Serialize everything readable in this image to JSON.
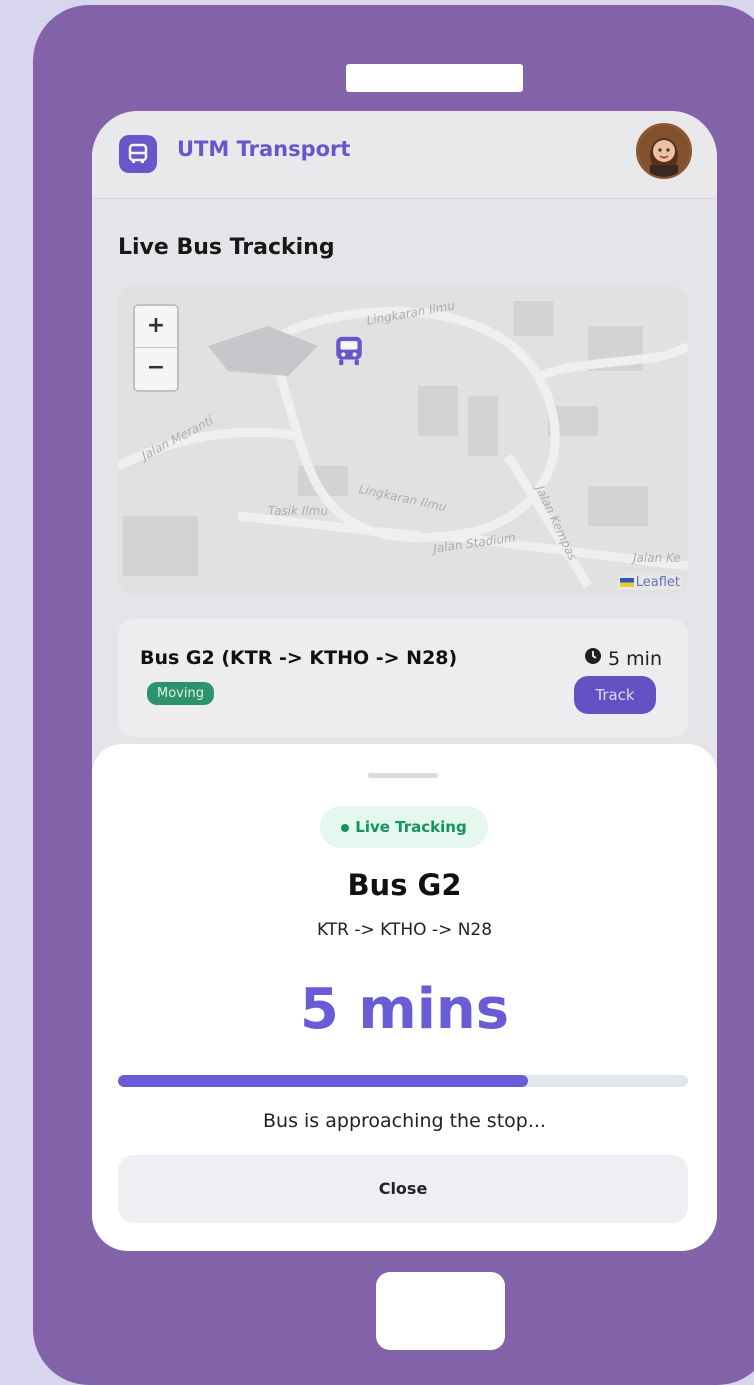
{
  "app": {
    "title": "UTM Transport",
    "icon": "bus-icon",
    "accent_color": "#6c5bd4",
    "frame_color": "#8262a8"
  },
  "main": {
    "section_title": "Live Bus Tracking",
    "map": {
      "zoom_in_label": "+",
      "zoom_out_label": "−",
      "attribution": "Leaflet",
      "streets": [
        "Lingkaran Ilmu",
        "Jalan Meranti",
        "Lingkaran Ilmu",
        "Tasik Ilmu",
        "Jalan Stadium",
        "Jalan Kempas",
        "Jalan Ke"
      ]
    },
    "bus_card": {
      "route": "Bus G2 (KTR -> KTHO -> N28)",
      "status": "Moving",
      "eta": "5 min",
      "track_label": "Track",
      "status_color": "#2d9b73"
    }
  },
  "sheet": {
    "badge": "Live Tracking",
    "bus_name": "Bus G2",
    "route": "KTR -> KTHO -> N28",
    "eta": "5 mins",
    "progress": 0.72,
    "status_text": "Bus is approaching the stop...",
    "close_label": "Close"
  }
}
